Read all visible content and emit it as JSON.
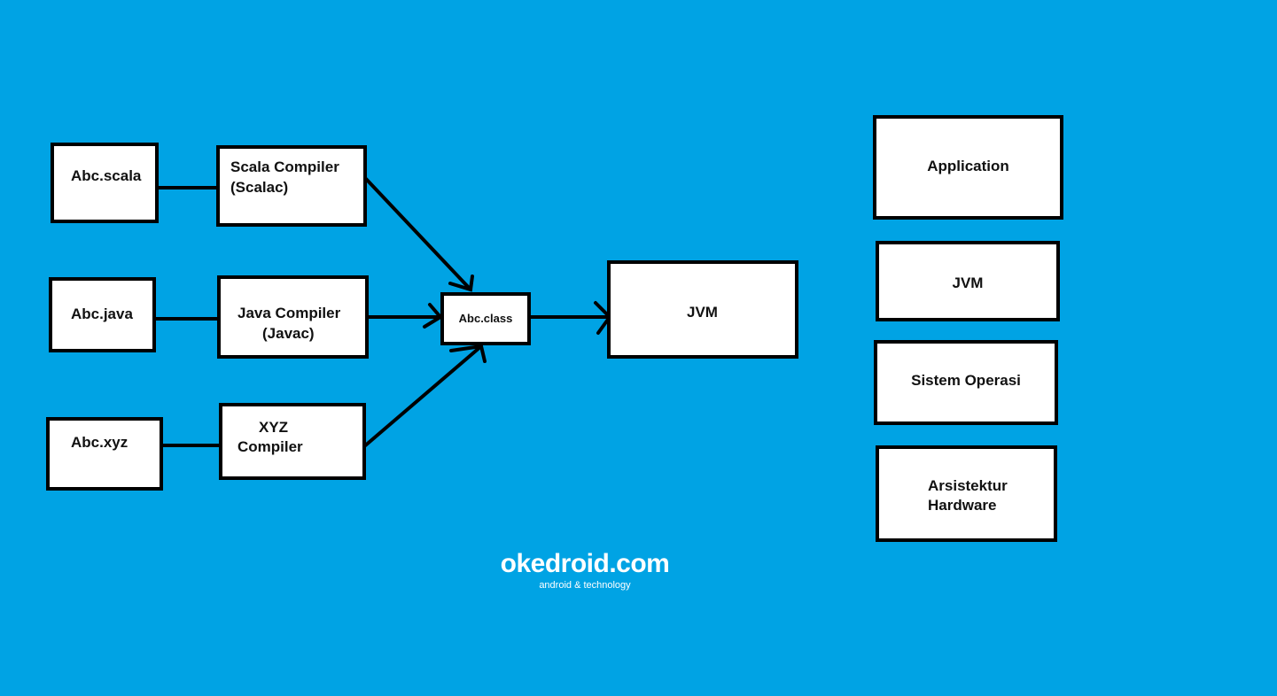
{
  "colors": {
    "background": "#00a3e4",
    "box_fill": "#ffffff",
    "stroke": "#000000"
  },
  "sources": [
    {
      "label": "Abc.scala"
    },
    {
      "label": "Abc.java"
    },
    {
      "label": "Abc.xyz"
    }
  ],
  "compilers": [
    {
      "line1": "Scala Compiler",
      "line2": "(Scalac)"
    },
    {
      "line1": "Java Compiler",
      "line2": "(Javac)"
    },
    {
      "line1": "XYZ",
      "line2": "Compiler"
    }
  ],
  "bytecode": {
    "label": "Abc.class"
  },
  "runtime": {
    "label": "JVM"
  },
  "stack": [
    {
      "label": "Application"
    },
    {
      "label": "JVM"
    },
    {
      "label": "Sistem Operasi"
    },
    {
      "line1": "Arsistektur",
      "line2": "Hardware"
    }
  ],
  "watermark": {
    "title": "okedroid.com",
    "tagline": "android & technology"
  }
}
